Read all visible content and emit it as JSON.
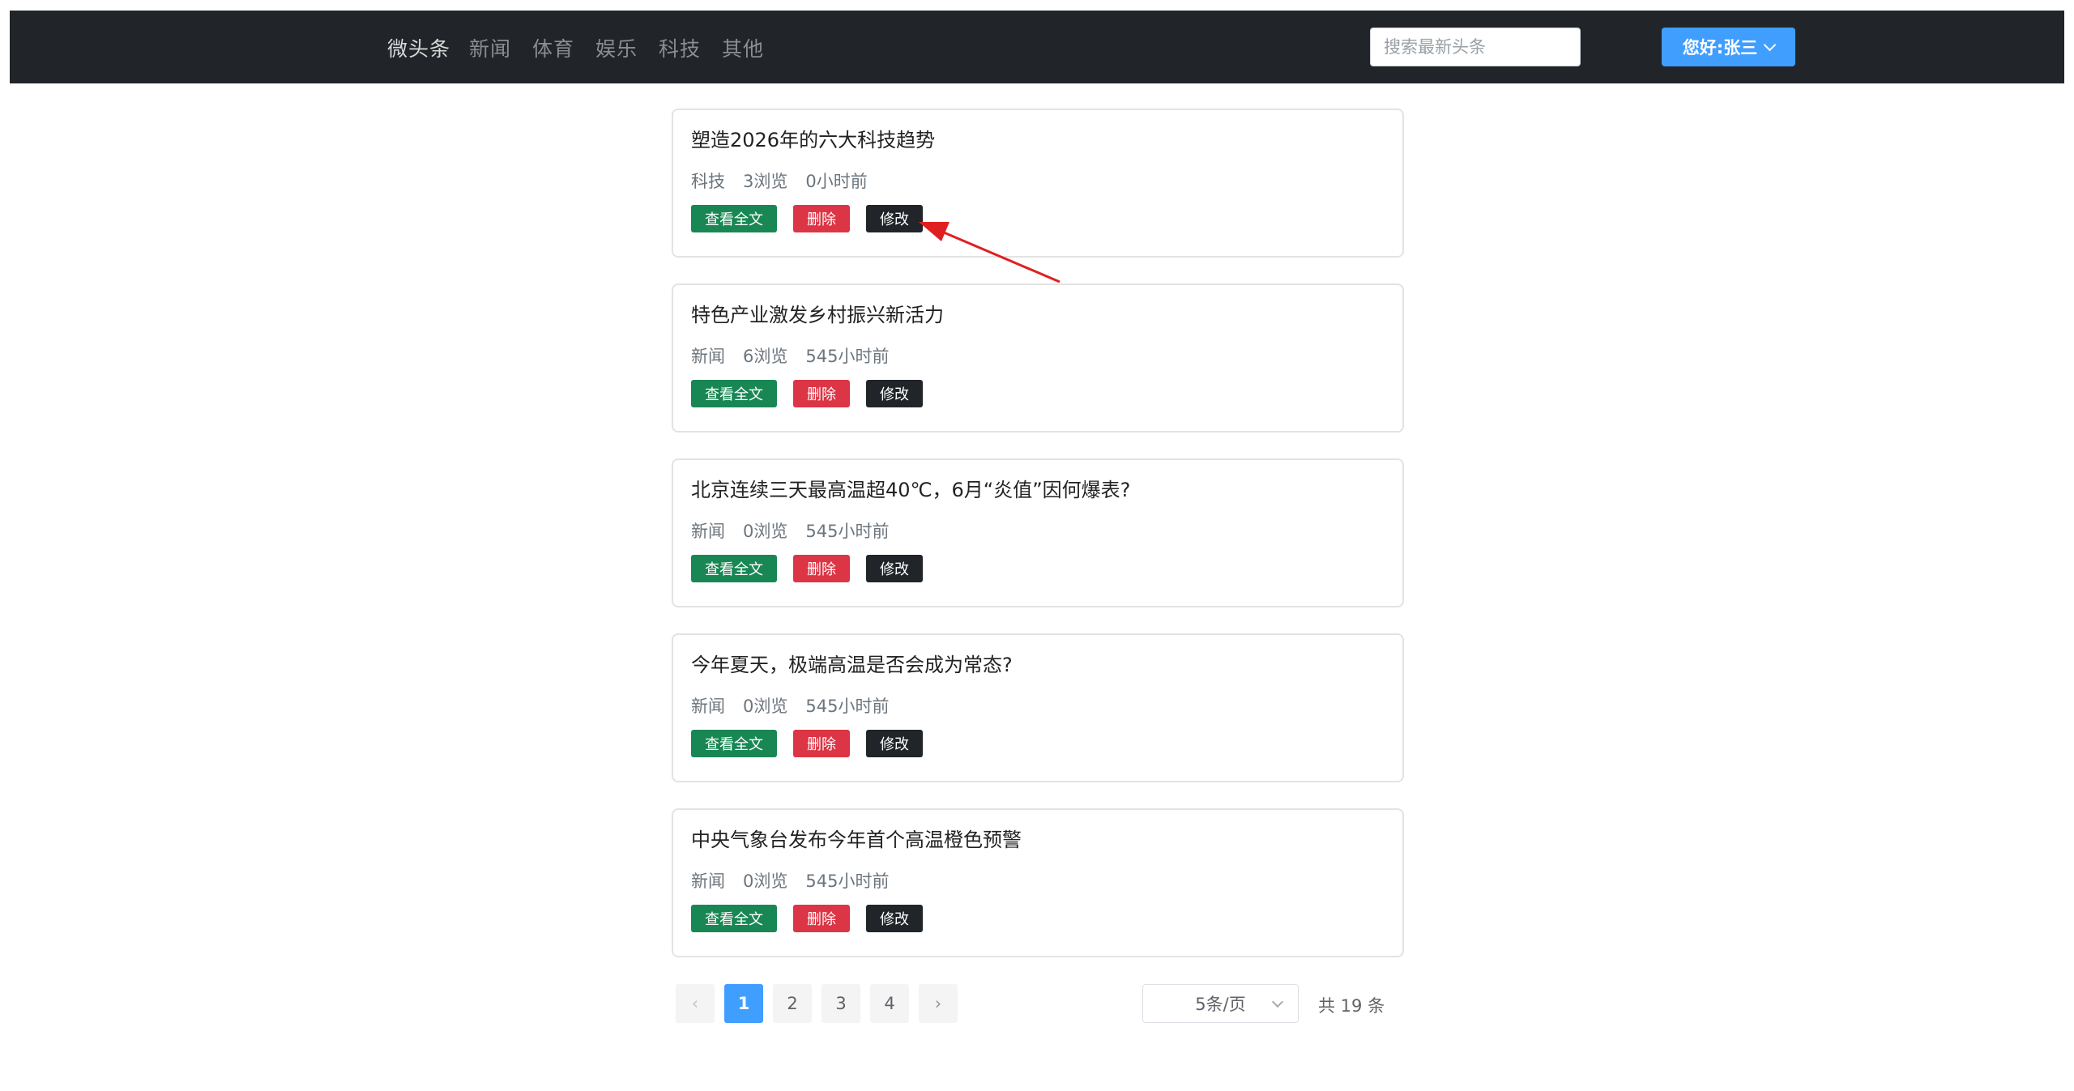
{
  "navbar": {
    "brand": "微头条",
    "links": [
      "新闻",
      "体育",
      "娱乐",
      "科技",
      "其他"
    ],
    "search_placeholder": "搜索最新头条",
    "user_label": "您好:张三"
  },
  "articles": [
    {
      "title": "塑造2026年的六大科技趋势",
      "category": "科技",
      "views": "3浏览",
      "time": "0小时前"
    },
    {
      "title": "特色产业激发乡村振兴新活力",
      "category": "新闻",
      "views": "6浏览",
      "time": "545小时前"
    },
    {
      "title": "北京连续三天最高温超40℃，6月“炎值”因何爆表?",
      "category": "新闻",
      "views": "0浏览",
      "time": "545小时前"
    },
    {
      "title": "今年夏天，极端高温是否会成为常态?",
      "category": "新闻",
      "views": "0浏览",
      "time": "545小时前"
    },
    {
      "title": "中央气象台发布今年首个高温橙色预警",
      "category": "新闻",
      "views": "0浏览",
      "time": "545小时前"
    }
  ],
  "actions": {
    "view": "查看全文",
    "delete": "删除",
    "edit": "修改"
  },
  "pagination": {
    "prev_icon": "‹",
    "pages": [
      "1",
      "2",
      "3",
      "4"
    ],
    "current": "1",
    "next_icon": "›",
    "page_size": "5条/页",
    "total": "共 19 条"
  },
  "colors": {
    "navbar_bg": "#212529",
    "primary": "#409eff",
    "success": "#198754",
    "danger": "#dc3545",
    "dark": "#212529",
    "annotation_arrow": "#e02020"
  }
}
